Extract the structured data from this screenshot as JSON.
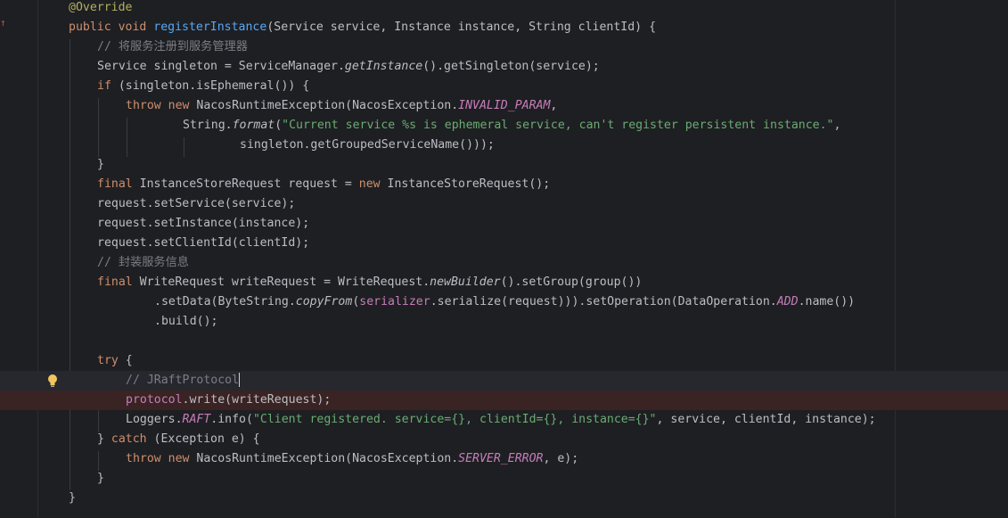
{
  "editor": {
    "language": "Java",
    "colors": {
      "background": "#1e1f22",
      "keyword": "#cf8e6d",
      "annotation": "#b3ae60",
      "method_declaration": "#56a8f5",
      "comment": "#7a7e85",
      "string": "#6aab73",
      "static_constant": "#c77dbb",
      "text": "#bcbec4",
      "current_line": "#26282e",
      "breakpoint_line": "#3a2323"
    },
    "gutter_icons": {
      "override_marker": "override-arrow-icon",
      "intention": "lightbulb-icon"
    },
    "lines": {
      "l1": {
        "ann": "@Override"
      },
      "l2": {
        "kw": "public void ",
        "fn": "registerInstance",
        "rest": "(Service service, Instance instance, String clientId) {"
      },
      "l3": {
        "cm": "// 将服务注册到服务管理器"
      },
      "l4": {
        "a": "Service singleton = ServiceManager.",
        "b": "getInstance",
        "c": "().getSingleton(service);"
      },
      "l5": {
        "kw": "if",
        "rest": " (singleton.isEphemeral()) {"
      },
      "l6": {
        "kw": "throw new",
        "a": " NacosRuntimeException(NacosException.",
        "const": "INVALID_PARAM",
        "b": ","
      },
      "l7": {
        "a": "String.",
        "b": "format",
        "c": "(",
        "str": "\"Current service %s is ephemeral service, can't register persistent instance.\"",
        "d": ","
      },
      "l8": {
        "text": "singleton.getGroupedServiceName()));"
      },
      "l9": {
        "text": "}"
      },
      "l10": {
        "kw": "final",
        "a": " InstanceStoreRequest request = ",
        "kw2": "new",
        "b": " InstanceStoreRequest();"
      },
      "l11": {
        "text": "request.setService(service);"
      },
      "l12": {
        "text": "request.setInstance(instance);"
      },
      "l13": {
        "text": "request.setClientId(clientId);"
      },
      "l14": {
        "cm": "// 封装服务信息"
      },
      "l15": {
        "kw": "final",
        "a": " WriteRequest writeRequest = WriteRequest.",
        "b": "newBuilder",
        "c": "().setGroup(group())"
      },
      "l16": {
        "a": ".setData(ByteString.",
        "b": "copyFrom",
        "c": "(",
        "fld": "serializer",
        "d": ".serialize(request))).setOperation(DataOperation.",
        "const": "ADD",
        "e": ".name())"
      },
      "l17": {
        "text": ".build();"
      },
      "l18": {
        "text": ""
      },
      "l19": {
        "kw": "try",
        "rest": " {"
      },
      "l20": {
        "cm": "// JRaftProtocol"
      },
      "l21": {
        "fld": "protocol",
        "rest": ".write(writeRequest);"
      },
      "l22": {
        "a": "Loggers.",
        "const": "RAFT",
        "b": ".info(",
        "str": "\"Client registered. service={}, clientId={}, instance={}\"",
        "c": ", service, clientId, instance);"
      },
      "l23": {
        "a": "} ",
        "kw": "catch",
        "b": " (Exception e) {"
      },
      "l24": {
        "kw": "throw new",
        "a": " NacosRuntimeException(NacosException.",
        "const": "SERVER_ERROR",
        "b": ", e);"
      },
      "l25": {
        "text": "}"
      },
      "l26": {
        "text": "}"
      }
    }
  }
}
